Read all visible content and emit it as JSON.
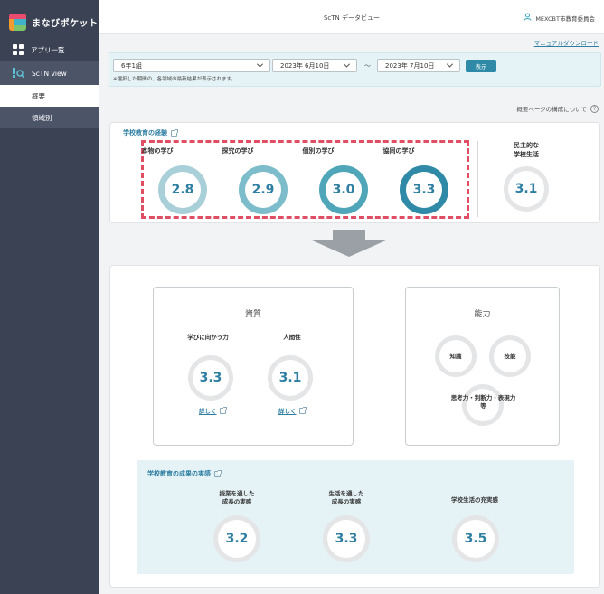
{
  "app": {
    "brand": "まなびポケット",
    "header_title": "ScTN データビュー",
    "user": "MEXCBT市教育委員会",
    "manual_link": "マニュアルダウンロード"
  },
  "sidebar": {
    "items": [
      {
        "label": "アプリ一覧",
        "icon": "app-grid-icon"
      },
      {
        "label": "ScTN view",
        "icon": "sctn-view-icon"
      }
    ],
    "sub_items": [
      {
        "label": "概要"
      },
      {
        "label": "領域別"
      }
    ]
  },
  "filter": {
    "class_select": "6年1組",
    "date_from": "2023年 6月10日",
    "tilde": "〜",
    "date_to": "2023年 7月10日",
    "show_button": "表示",
    "note": "※選択した期間の、各領域の最新結果が表示されます。"
  },
  "about_link": "概要ページの構成について",
  "experience": {
    "title": "学校教育の経験",
    "metrics": [
      {
        "label": "本物の学び",
        "value": "2.8"
      },
      {
        "label": "探究の学び",
        "value": "2.9"
      },
      {
        "label": "個別の学び",
        "value": "3.0"
      },
      {
        "label": "協同の学び",
        "value": "3.3"
      }
    ],
    "democratic": {
      "label_line1": "民主的な",
      "label_line2": "学校生活",
      "value": "3.1"
    }
  },
  "qualities": {
    "title": "資質",
    "items": [
      {
        "label": "学びに向かう力",
        "value": "3.3",
        "link": "詳しく"
      },
      {
        "label": "人間性",
        "value": "3.1",
        "link": "詳しく"
      }
    ]
  },
  "abilities": {
    "title": "能力",
    "items": [
      {
        "label": "知識"
      },
      {
        "label": "技能"
      },
      {
        "label_line1": "思考力・判断力・表現力",
        "label_line2": "等"
      }
    ]
  },
  "results": {
    "title": "学校教育の成果の実感",
    "items": [
      {
        "label_line1": "授業を通した",
        "label_line2": "成長の実感",
        "value": "3.2"
      },
      {
        "label_line1": "生活を通した",
        "label_line2": "成長の実感",
        "value": "3.3"
      },
      {
        "label_line1": "学校生活の充実感",
        "label_line2": "",
        "value": "3.5"
      }
    ]
  },
  "colors": {
    "ring_2_8": "#a9cfd9",
    "ring_2_9": "#7dbccb",
    "ring_3_0": "#4fa6b9",
    "ring_3_3": "#2e8aa6",
    "ring_neutral": "#e4e5e7",
    "dashed": "#e04e64",
    "accent": "#2f7fa3",
    "sidebar": "#3b4254"
  }
}
